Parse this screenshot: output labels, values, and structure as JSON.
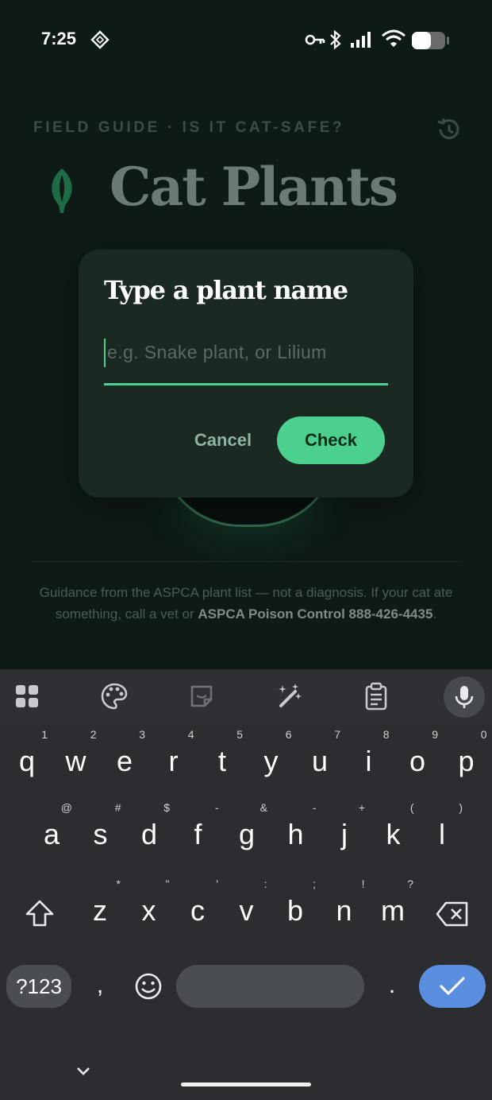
{
  "status_bar": {
    "time": "7:25"
  },
  "app": {
    "kicker": "FIELD GUIDE · IS IT CAT-SAFE?",
    "title": "Cat Plants",
    "disclaimer_pre": "Guidance from the ASPCA plant list — not a diagnosis. If your cat ate something, call a vet or ",
    "disclaimer_bold": "ASPCA Poison Control 888-426-4435",
    "disclaimer_post": "."
  },
  "dialog": {
    "title": "Type a plant name",
    "input_placeholder": "e.g. Snake plant, or Lilium",
    "input_value": "",
    "cancel_label": "Cancel",
    "check_label": "Check"
  },
  "keyboard": {
    "row1": [
      {
        "k": "q",
        "h": "1"
      },
      {
        "k": "w",
        "h": "2"
      },
      {
        "k": "e",
        "h": "3"
      },
      {
        "k": "r",
        "h": "4"
      },
      {
        "k": "t",
        "h": "5"
      },
      {
        "k": "y",
        "h": "6"
      },
      {
        "k": "u",
        "h": "7"
      },
      {
        "k": "i",
        "h": "8"
      },
      {
        "k": "o",
        "h": "9"
      },
      {
        "k": "p",
        "h": "0"
      }
    ],
    "row2": [
      {
        "k": "a",
        "h": "@"
      },
      {
        "k": "s",
        "h": "#"
      },
      {
        "k": "d",
        "h": "$"
      },
      {
        "k": "f",
        "h": "-"
      },
      {
        "k": "g",
        "h": "&"
      },
      {
        "k": "h",
        "h": "-"
      },
      {
        "k": "j",
        "h": "+"
      },
      {
        "k": "k",
        "h": "("
      },
      {
        "k": "l",
        "h": ")"
      }
    ],
    "row3": [
      {
        "k": "z",
        "h": "*"
      },
      {
        "k": "x",
        "h": "\""
      },
      {
        "k": "c",
        "h": "'"
      },
      {
        "k": "v",
        "h": ":"
      },
      {
        "k": "b",
        "h": ";"
      },
      {
        "k": "n",
        "h": "!"
      },
      {
        "k": "m",
        "h": "?"
      }
    ],
    "symbols_label": "?123",
    "comma": ",",
    "period": "."
  },
  "colors": {
    "accent": "#4cd08e",
    "enter_key": "#5a8fe0"
  }
}
